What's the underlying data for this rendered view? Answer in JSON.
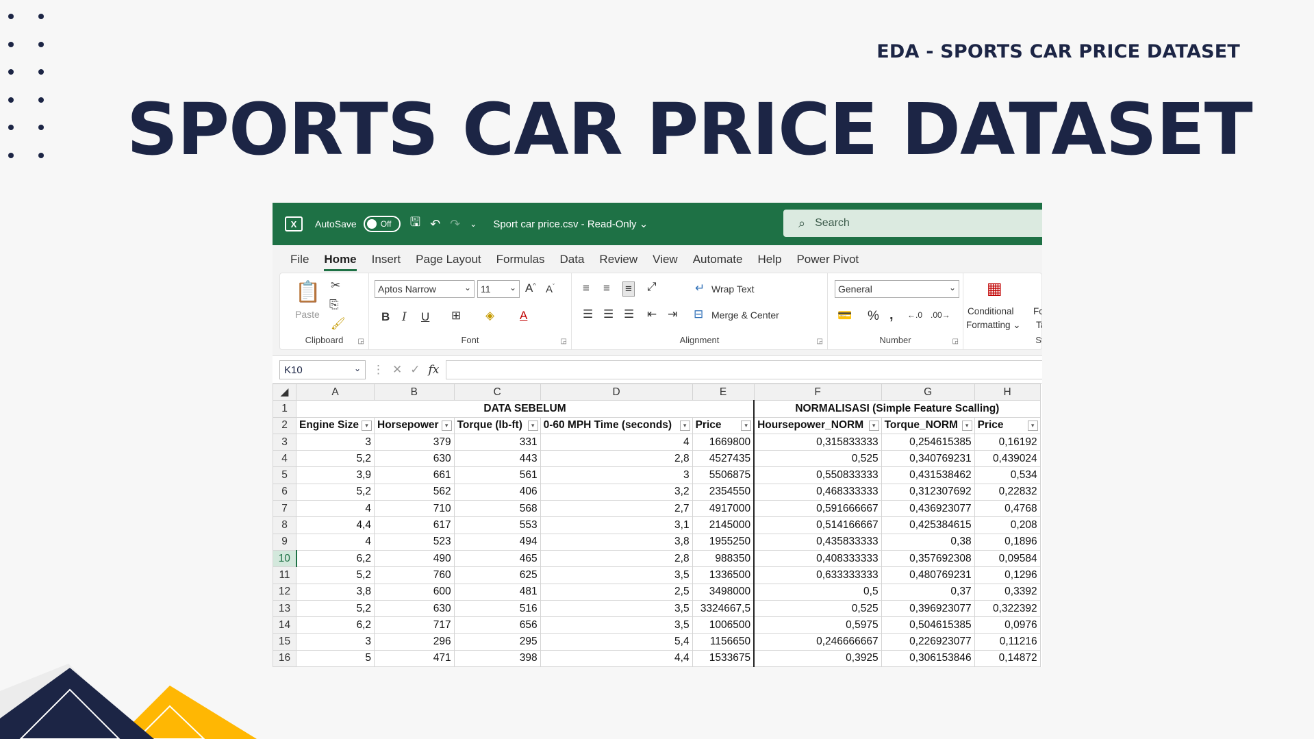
{
  "slide": {
    "subtitle": "EDA - SPORTS CAR PRICE DATASET",
    "title": "SPORTS CAR PRICE DATASET",
    "colors": {
      "navy": "#1c2545",
      "yellow": "#ffb703",
      "background": "#f7f7f7"
    }
  },
  "excel": {
    "titlebar": {
      "app_icon": "excel-logo-icon",
      "autosave_label": "AutoSave",
      "autosave_state": "Off",
      "filename": "Sport car price.csv  -  Read-Only ⌄",
      "search_placeholder": "Search"
    },
    "menu": [
      "File",
      "Home",
      "Insert",
      "Page Layout",
      "Formulas",
      "Data",
      "Review",
      "View",
      "Automate",
      "Help",
      "Power Pivot"
    ],
    "menu_active": "Home",
    "ribbon": {
      "clipboard": {
        "paste": "Paste",
        "label": "Clipboard"
      },
      "font": {
        "family": "Aptos Narrow",
        "size": "11",
        "label": "Font",
        "bold": "B",
        "italic": "I",
        "underline": "U"
      },
      "alignment": {
        "wrap_text": "Wrap Text",
        "merge_center": "Merge & Center",
        "label": "Alignment"
      },
      "number": {
        "format": "General",
        "label": "Number"
      },
      "styles": {
        "conditional_line1": "Conditional",
        "conditional_line2": "Formatting ⌄",
        "format_line1": "Fo",
        "format_line2": "Ta",
        "label": "Sty"
      }
    },
    "formula_bar": {
      "name_box": "K10",
      "fx": "fx",
      "value": ""
    },
    "sheet": {
      "columns": [
        "A",
        "B",
        "C",
        "D",
        "E",
        "F",
        "G",
        "H"
      ],
      "group_headers": {
        "before": "DATA SEBELUM",
        "normalized": "NORMALISASI (Simple Feature Scalling)"
      },
      "headers": [
        "Engine Size",
        "Horsepower",
        "Torque (lb-ft)",
        "0-60 MPH Time (seconds)",
        "Price",
        "Hoursepower_NORM",
        "Torque_NORM",
        "Price"
      ],
      "selected_row": "10",
      "rows": [
        {
          "n": "3",
          "cells": [
            "3",
            "379",
            "331",
            "4",
            "1669800",
            "0,315833333",
            "0,254615385",
            "0,16192"
          ]
        },
        {
          "n": "4",
          "cells": [
            "5,2",
            "630",
            "443",
            "2,8",
            "4527435",
            "0,525",
            "0,340769231",
            "0,439024"
          ]
        },
        {
          "n": "5",
          "cells": [
            "3,9",
            "661",
            "561",
            "3",
            "5506875",
            "0,550833333",
            "0,431538462",
            "0,534"
          ]
        },
        {
          "n": "6",
          "cells": [
            "5,2",
            "562",
            "406",
            "3,2",
            "2354550",
            "0,468333333",
            "0,312307692",
            "0,22832"
          ]
        },
        {
          "n": "7",
          "cells": [
            "4",
            "710",
            "568",
            "2,7",
            "4917000",
            "0,591666667",
            "0,436923077",
            "0,4768"
          ]
        },
        {
          "n": "8",
          "cells": [
            "4,4",
            "617",
            "553",
            "3,1",
            "2145000",
            "0,514166667",
            "0,425384615",
            "0,208"
          ]
        },
        {
          "n": "9",
          "cells": [
            "4",
            "523",
            "494",
            "3,8",
            "1955250",
            "0,435833333",
            "0,38",
            "0,1896"
          ]
        },
        {
          "n": "10",
          "cells": [
            "6,2",
            "490",
            "465",
            "2,8",
            "988350",
            "0,408333333",
            "0,357692308",
            "0,09584"
          ]
        },
        {
          "n": "11",
          "cells": [
            "5,2",
            "760",
            "625",
            "3,5",
            "1336500",
            "0,633333333",
            "0,480769231",
            "0,1296"
          ]
        },
        {
          "n": "12",
          "cells": [
            "3,8",
            "600",
            "481",
            "2,5",
            "3498000",
            "0,5",
            "0,37",
            "0,3392"
          ]
        },
        {
          "n": "13",
          "cells": [
            "5,2",
            "630",
            "516",
            "3,5",
            "3324667,5",
            "0,525",
            "0,396923077",
            "0,322392"
          ]
        },
        {
          "n": "14",
          "cells": [
            "6,2",
            "717",
            "656",
            "3,5",
            "1006500",
            "0,5975",
            "0,504615385",
            "0,0976"
          ]
        },
        {
          "n": "15",
          "cells": [
            "3",
            "296",
            "295",
            "5,4",
            "1156650",
            "0,246666667",
            "0,226923077",
            "0,11216"
          ]
        },
        {
          "n": "16",
          "cells": [
            "5",
            "471",
            "398",
            "4,4",
            "1533675",
            "0,3925",
            "0,306153846",
            "0,14872"
          ]
        }
      ]
    }
  }
}
